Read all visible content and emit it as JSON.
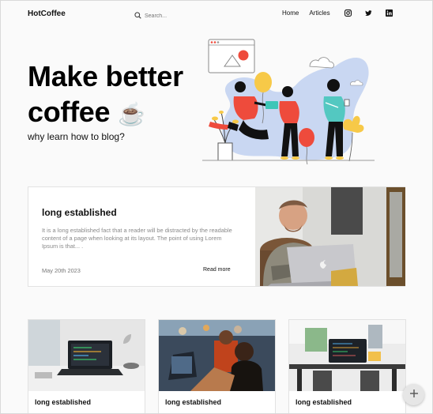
{
  "brand": "HotCoffee",
  "search": {
    "placeholder": "Search..."
  },
  "nav": {
    "links": [
      "Home",
      "Articles"
    ],
    "social": [
      "instagram-icon",
      "twitter-icon",
      "linkedin-icon"
    ]
  },
  "hero": {
    "title_line1": "Make better",
    "title_line2": "coffee",
    "title_emoji": "☕",
    "subtitle": "why learn how to blog?"
  },
  "featured": {
    "title": "long established",
    "text": "It is a long established fact that a reader will be distracted by the readable content of a page when looking at its layout. The point of using Lorem Ipsum is that... .",
    "date": "May 20th 2023",
    "read_more": "Read more"
  },
  "cards": [
    {
      "title": "long established"
    },
    {
      "title": "long established"
    },
    {
      "title": "long established"
    }
  ],
  "colors": {
    "accent_red": "#ee4b3c",
    "accent_yellow": "#f7c948",
    "blob_blue": "#c9d7f2"
  }
}
